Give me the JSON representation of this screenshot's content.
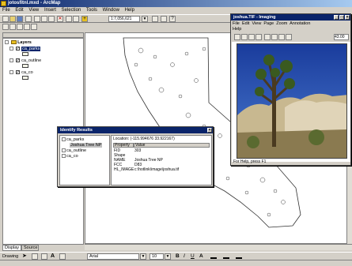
{
  "app": {
    "title": "jotosfitnl.mxd - ArcMap"
  },
  "menu": [
    "File",
    "Edit",
    "View",
    "Insert",
    "Selection",
    "Tools",
    "Window",
    "Help"
  ],
  "toolbar": {
    "scale": "1:7,056,621"
  },
  "toc": {
    "root_label": "Layers",
    "layers": [
      {
        "name": "ca_parks",
        "selected": true
      },
      {
        "name": "ca_outline",
        "selected": false
      },
      {
        "name": "ca_co",
        "selected": false
      }
    ],
    "tabs": [
      "Display",
      "Source"
    ]
  },
  "identify": {
    "title": "Identify Results",
    "tree": [
      "ca_parks",
      "Joshua Tree NP",
      "ca_outline",
      "ca_co"
    ],
    "location": "Location: (-115.994676  33.922167)",
    "headers": [
      "Property",
      "Value"
    ],
    "rows": [
      [
        "FID",
        "303"
      ],
      [
        "Shape",
        ""
      ],
      [
        "NAME",
        "Joshua Tree NP"
      ],
      [
        "FCC",
        "D83"
      ],
      [
        "HL_IMAGE",
        "c:\\hotlink\\image\\joshua.tif"
      ]
    ]
  },
  "image_viewer": {
    "title": "joshua.TIF - Imaging",
    "menu": [
      "File",
      "Edit",
      "View",
      "Page",
      "Zoom",
      "Annotation",
      "Help"
    ],
    "zoom": "43.00",
    "status": "For Help, press F1"
  },
  "drawing": {
    "label": "Drawing",
    "font": "Arial",
    "size": "10",
    "styles": [
      "B",
      "I",
      "U"
    ]
  },
  "colors": {
    "title_blue": "#0a246a",
    "selection": "#0a246a",
    "chrome": "#d4d0c8"
  }
}
